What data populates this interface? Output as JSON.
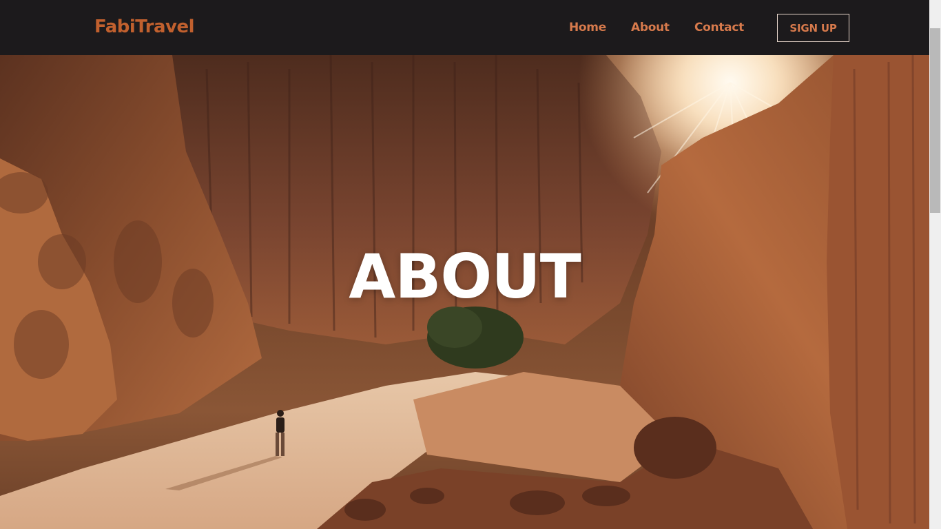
{
  "brand": {
    "name": "FabiTravel"
  },
  "nav": {
    "items": [
      {
        "label": "Home"
      },
      {
        "label": "About"
      },
      {
        "label": "Contact"
      }
    ],
    "signup_label": "SIGN UP"
  },
  "hero": {
    "title": "ABOUT"
  },
  "colors": {
    "navbar_bg": "#1c1a1c",
    "brand": "#c1602e",
    "nav_link": "#d77a4c",
    "hero_title": "#ffffff"
  }
}
